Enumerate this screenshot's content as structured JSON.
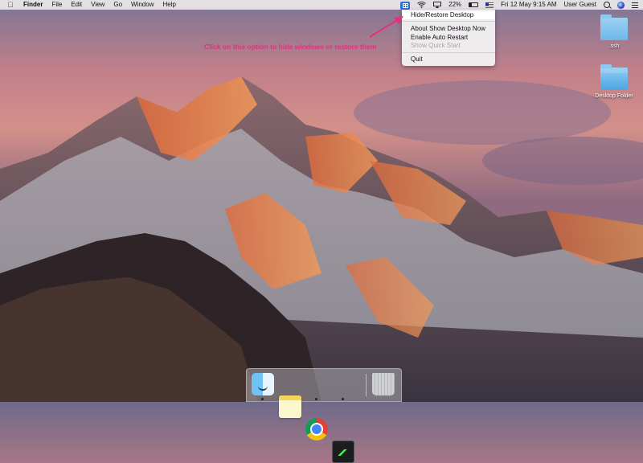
{
  "menubar": {
    "apple_icon": "apple-icon",
    "app_name": "Finder",
    "menus": [
      "File",
      "Edit",
      "View",
      "Go",
      "Window",
      "Help"
    ],
    "status": {
      "show_desktop_icon": "show-desktop-icon",
      "battery_percent": "22%",
      "datetime": "Fri 12 May  9:15 AM",
      "user": "User Guest"
    }
  },
  "dropdown": {
    "items": [
      {
        "label": "Hide/Restore Desktop",
        "enabled": true
      },
      {
        "label": "About Show Desktop Now",
        "enabled": true
      },
      {
        "label": "Enable Auto Restart",
        "enabled": true
      },
      {
        "label": "Show Quick Start",
        "enabled": false
      },
      {
        "label": "Quit",
        "enabled": true
      }
    ]
  },
  "annotation": {
    "text": "Click on this option to hide windows or restore them",
    "color": "#e8307a"
  },
  "desktop": {
    "icons": [
      {
        "label": ".ssh",
        "icon": "folder-icon"
      },
      {
        "label": "Desktop Folder",
        "icon": "folder-icon"
      }
    ]
  },
  "dock": {
    "apps": [
      {
        "name": "finder",
        "icon": "finder-icon",
        "running": true
      },
      {
        "name": "notes",
        "icon": "notes-icon",
        "running": false
      },
      {
        "name": "chrome",
        "icon": "chrome-icon",
        "running": true
      },
      {
        "name": "activity-monitor",
        "icon": "activity-monitor-icon",
        "running": true
      },
      {
        "name": "trash",
        "icon": "trash-icon",
        "running": false
      }
    ]
  },
  "colors": {
    "accent": "#2d6fd6",
    "annotation": "#e8307a"
  }
}
